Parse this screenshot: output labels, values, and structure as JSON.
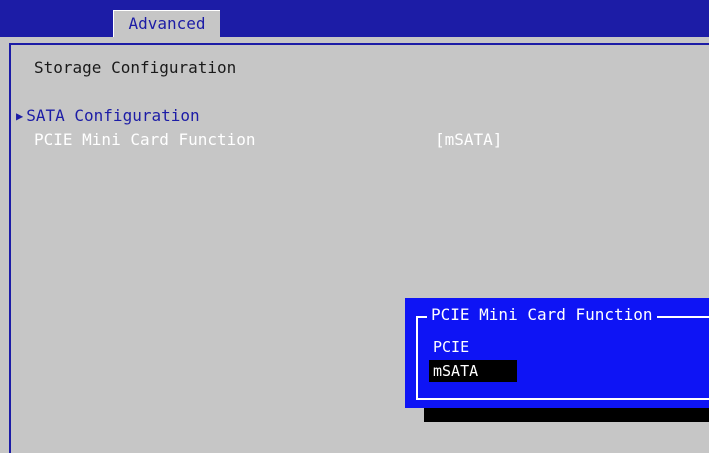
{
  "tabs": [
    {
      "label": "Advanced",
      "active": true
    }
  ],
  "page": {
    "title": "Storage Configuration"
  },
  "items": [
    {
      "label": "SATA Configuration",
      "submenu": true
    },
    {
      "label": "PCIE Mini Card Function",
      "value": "[mSATA]"
    }
  ],
  "popup": {
    "title": "PCIE Mini Card Function",
    "options": [
      "PCIE",
      "mSATA"
    ],
    "selected": "mSATA"
  },
  "colors": {
    "bios_background": "#c6c6c6",
    "bios_blue": "#1c1ca6",
    "popup_blue": "#0e14f5",
    "highlight_text": "#ffffff",
    "selected_option_bg": "#000000"
  }
}
